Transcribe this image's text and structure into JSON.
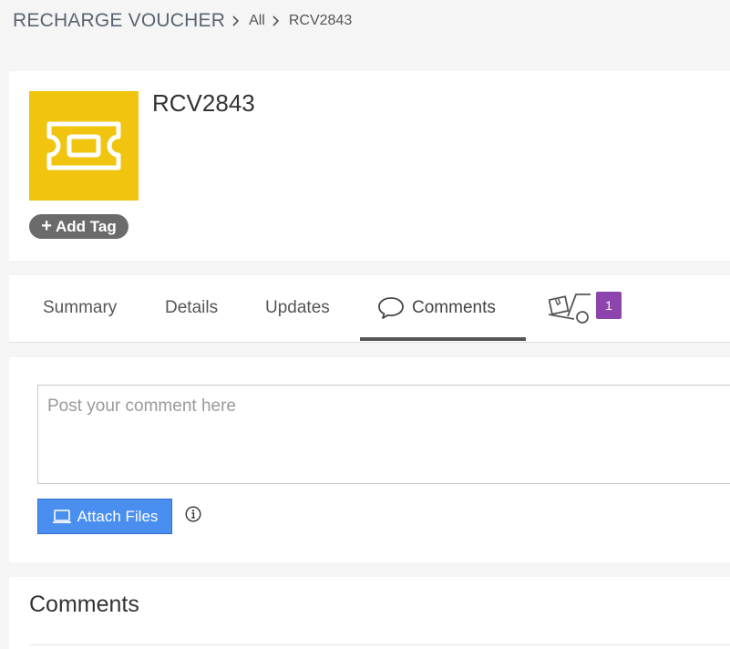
{
  "breadcrumb": {
    "root": "RECHARGE VOUCHER",
    "items": [
      "All",
      "RCV2843"
    ]
  },
  "record": {
    "title": "RCV2843",
    "icon": "ticket-icon",
    "icon_color": "#f1c40f",
    "add_tag_label": "Add Tag"
  },
  "tabs": {
    "items": [
      "Summary",
      "Details",
      "Updates",
      "Comments"
    ],
    "active": "Comments",
    "extra_icon": "hand-truck-icon",
    "extra_badge": "1",
    "badge_color": "#8e44ad"
  },
  "comment_form": {
    "placeholder": "Post your comment here",
    "attach_label": "Attach Files",
    "attach_color": "#4a8ff0"
  },
  "comments": {
    "heading": "Comments"
  }
}
